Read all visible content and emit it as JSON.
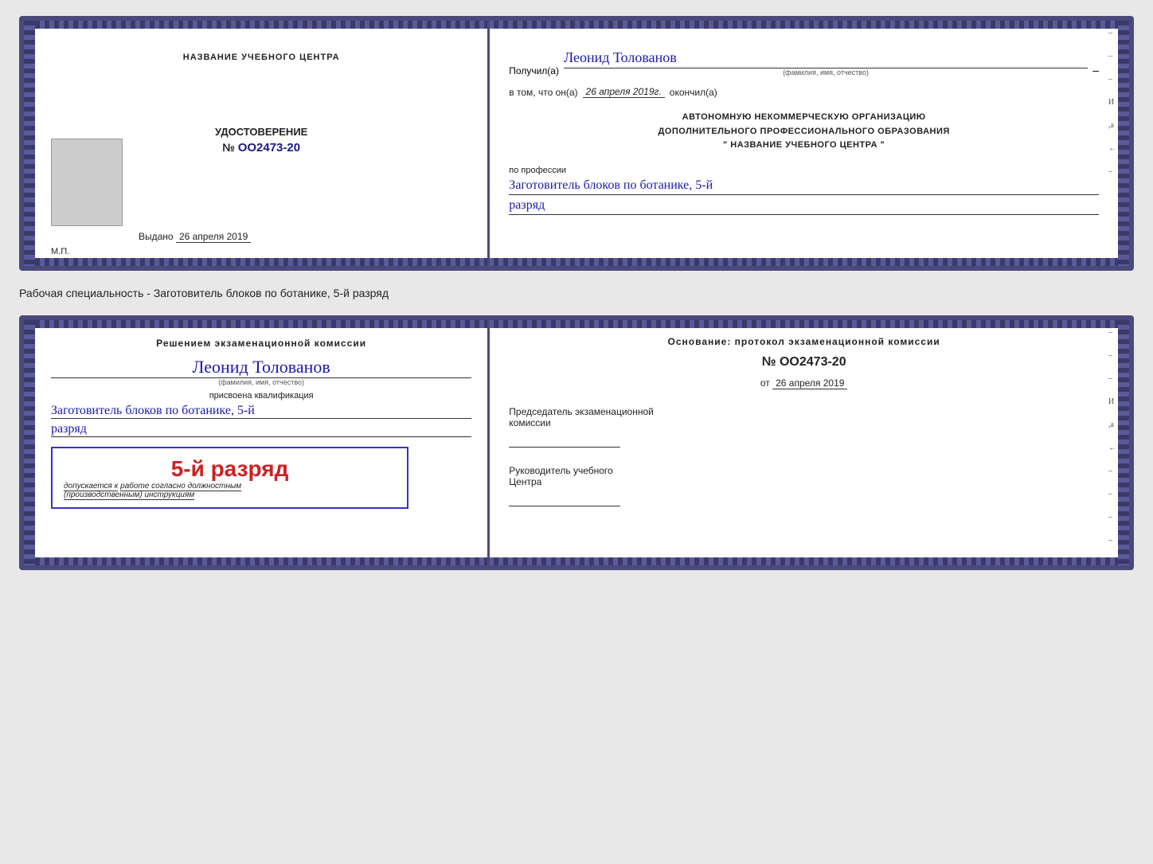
{
  "doc1": {
    "left": {
      "center_name": "НАЗВАНИЕ УЧЕБНОГО ЦЕНТРА",
      "udostoverenie_label": "УДОСТОВЕРЕНИЕ",
      "number_prefix": "№",
      "number": "OO2473-20",
      "vidano_label": "Выдано",
      "vidano_date": "26 апреля 2019",
      "mp_label": "М.П."
    },
    "right": {
      "poluchil_prefix": "Получил(а)",
      "person_name": "Леонид Толованов",
      "dash": "–",
      "fio_caption": "(фамилия, имя, отчество)",
      "vtom_text": "в том, что он(а)",
      "vtom_date": "26 апреля 2019г.",
      "okonchil": "окончил(а)",
      "auto_line1": "АВТОНОМНУЮ НЕКОММЕРЧЕСКУЮ ОРГАНИЗАЦИЮ",
      "auto_line2": "ДОПОЛНИТЕЛЬНОГО ПРОФЕССИОНАЛЬНОГО ОБРАЗОВАНИЯ",
      "auto_line3": "\" НАЗВАНИЕ УЧЕБНОГО ЦЕНТРА \"",
      "po_professii": "по профессии",
      "professiya": "Заготовитель блоков по ботанике, 5-й",
      "razryad": "разряд"
    }
  },
  "separator": {
    "text": "Рабочая специальность - Заготовитель блоков по ботанике, 5-й разряд"
  },
  "doc2": {
    "left": {
      "resheniem_text": "Решением экзаменационной комиссии",
      "person_name": "Леонид Толованов",
      "fio_caption": "(фамилия, имя, отчество)",
      "prisvoena": "присвоена квалификация",
      "qualif_text": "Заготовитель блоков по ботанике, 5-й",
      "razryad": "разряд",
      "stamp_text": "5-й разряд",
      "dopusk_label": "допускается к",
      "dopusk_text": "работе согласно должностным",
      "dopusk_text2": "(производственным) инструкциям"
    },
    "right": {
      "osnovanie_label": "Основание: протокол экзаменационной комиссии",
      "number_prefix": "№",
      "number": "OO2473-20",
      "ot_prefix": "от",
      "ot_date": "26 апреля 2019",
      "chairman_label": "Председатель экзаменационной",
      "chairman_label2": "комиссии",
      "rukov_label": "Руководитель учебного",
      "rukov_label2": "Центра"
    }
  },
  "margin_marks": [
    "-",
    "-",
    "-",
    "И",
    ",а",
    "←",
    "-",
    "-",
    "-",
    "-"
  ]
}
